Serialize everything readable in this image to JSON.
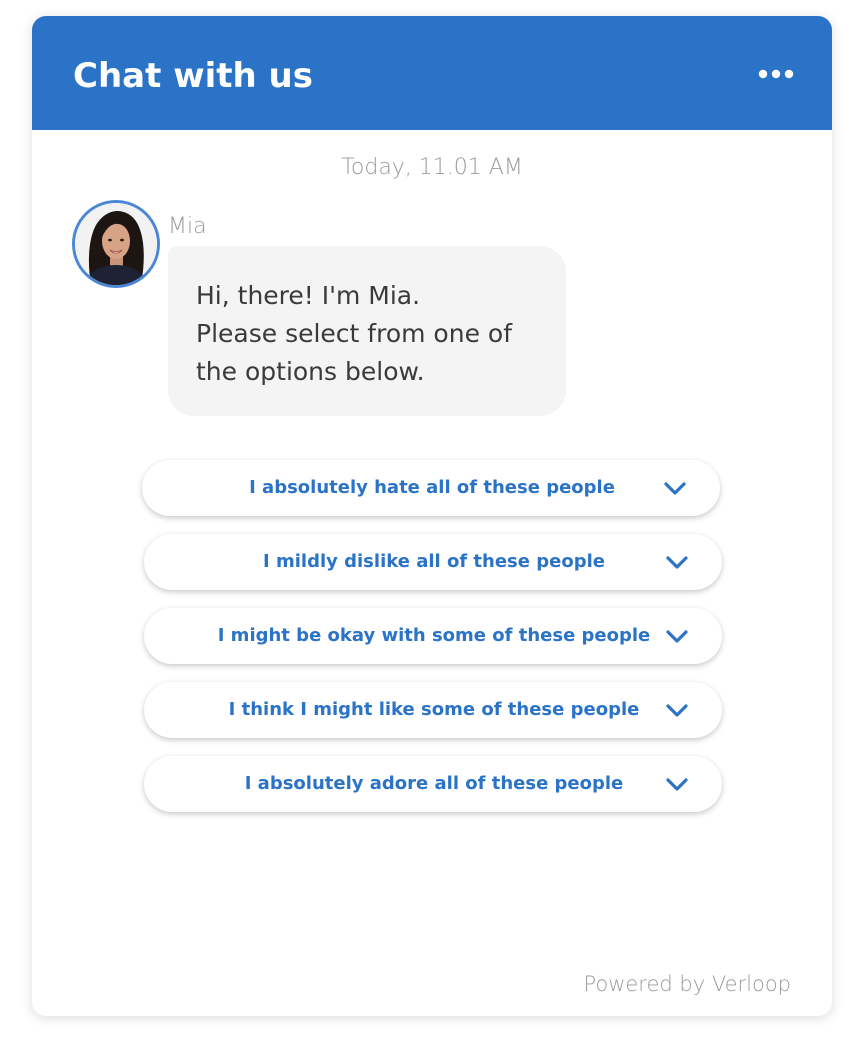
{
  "header": {
    "title": "Chat with us",
    "menu_icon": "more-horizontal-icon",
    "background_color": "#2b73c7"
  },
  "conversation": {
    "timestamp": "Today, 11.01 AM",
    "sender": {
      "name": "Mia",
      "avatar_icon": "agent-avatar"
    },
    "message_lines": [
      "Hi, there! I'm Mia.",
      "Please select from one of",
      "the options below."
    ]
  },
  "options": [
    {
      "label": "I absolutely hate all of these people",
      "icon": "chevron-down-icon"
    },
    {
      "label": "I mildly dislike all of these people",
      "icon": "chevron-down-icon"
    },
    {
      "label": "I might be okay with some of these people",
      "icon": "chevron-down-icon"
    },
    {
      "label": "I think I might like some of these people",
      "icon": "chevron-down-icon"
    },
    {
      "label": "I absolutely adore all of these people",
      "icon": "chevron-down-icon"
    }
  ],
  "footer": {
    "powered_by": "Powered by Verloop"
  },
  "colors": {
    "accent": "#2b73c7",
    "bubble": "#f4f4f4",
    "muted_text": "#9a9a9a"
  }
}
